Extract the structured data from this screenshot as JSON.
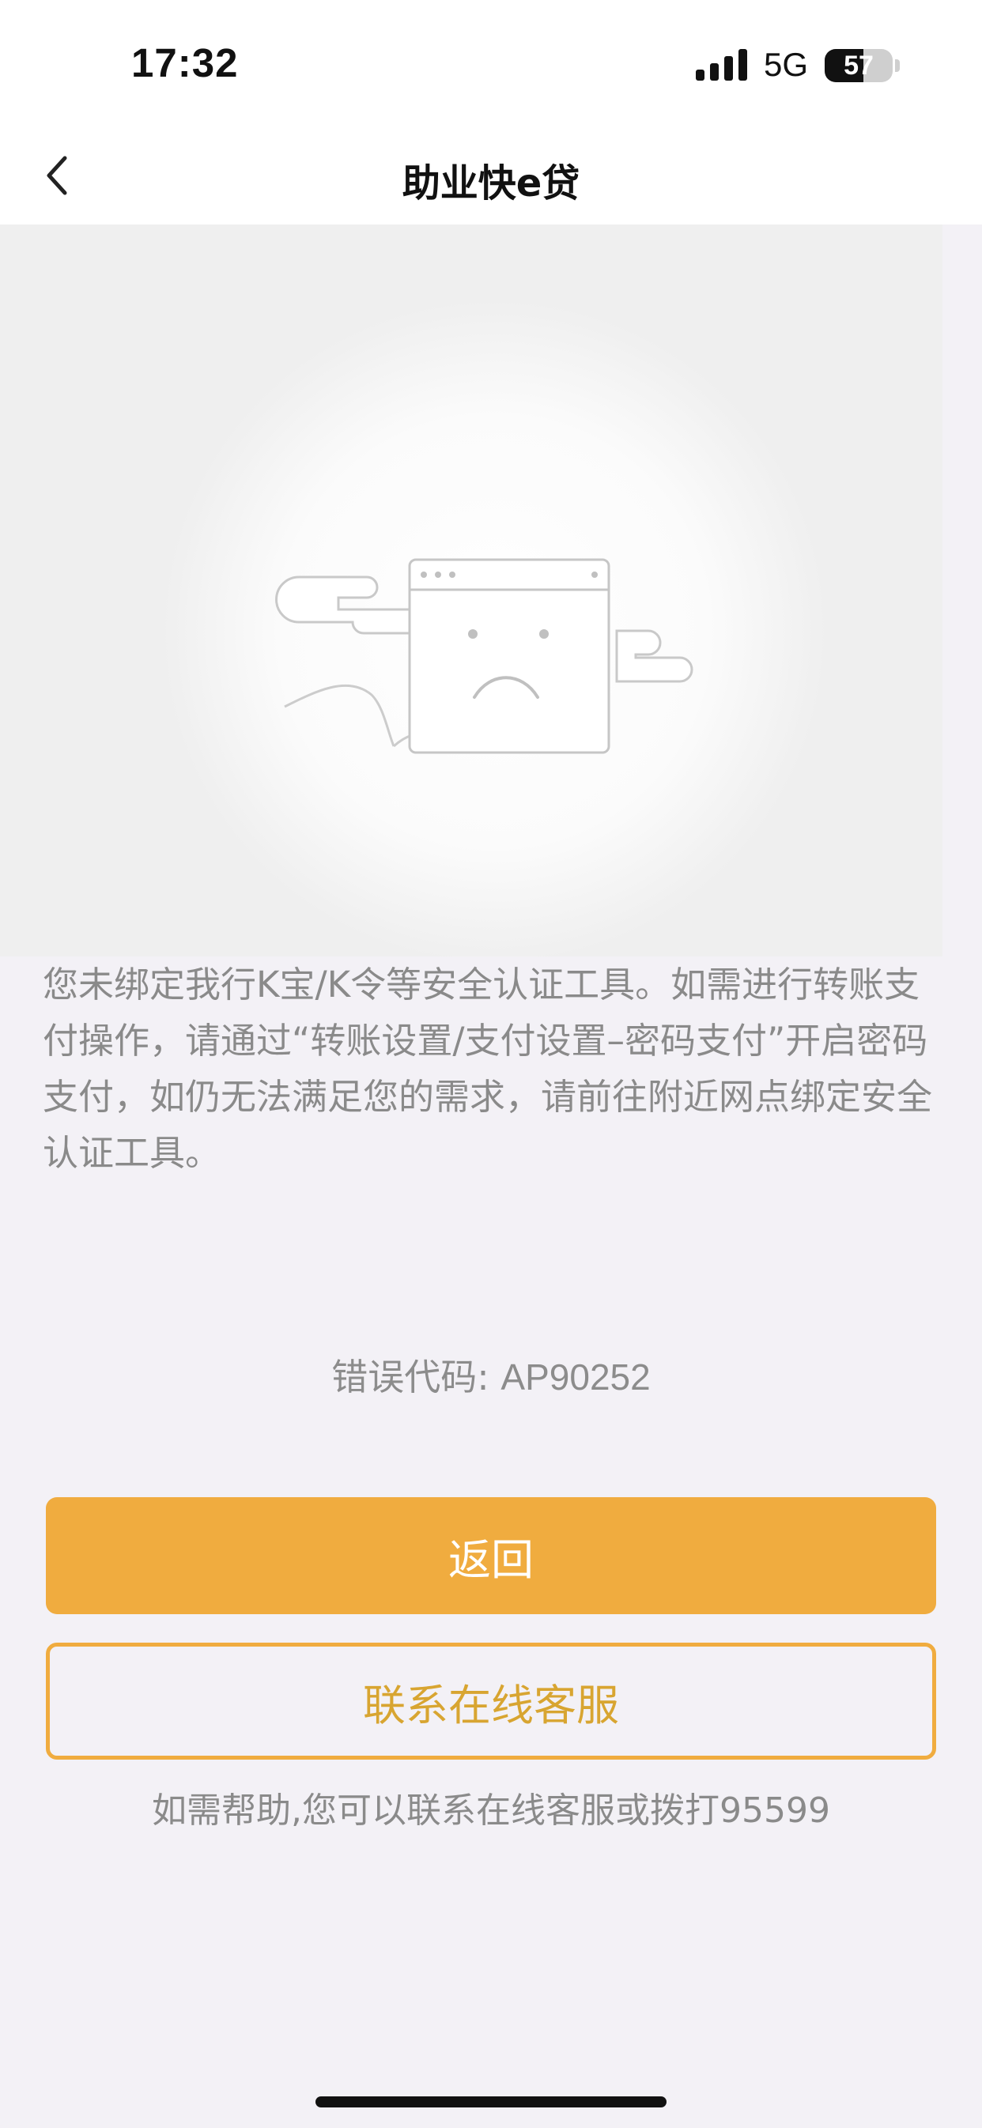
{
  "status_bar": {
    "time": "17:32",
    "network": "5G",
    "battery_level": "57",
    "battery_fraction": 0.57,
    "signal_icon": "cellular-signal-icon",
    "battery_icon": "battery-icon"
  },
  "nav": {
    "title": "助业快e贷",
    "back_icon": "chevron-left-icon"
  },
  "illustration": {
    "icon": "sad-browser-window-illustration"
  },
  "message": {
    "text": "您未绑定我行K宝/K令等安全认证工具。如需进行转账支付操作，请通过“转账设置/支付设置–密码支付”开启密码支付，如仍无法满足您的需求，请前往附近网点绑定安全认证工具。"
  },
  "error": {
    "label": "错误代码: ",
    "code": "AP90252"
  },
  "actions": {
    "back_label": "返回",
    "contact_label": "联系在线客服"
  },
  "help": {
    "text": "如需帮助,您可以联系在线客服或拨打95599"
  },
  "colors": {
    "accent": "#f0ac3f",
    "accent_text": "#d8a531",
    "page_background": "#f3f1f6",
    "secondary_text": "#8a8a8a"
  }
}
